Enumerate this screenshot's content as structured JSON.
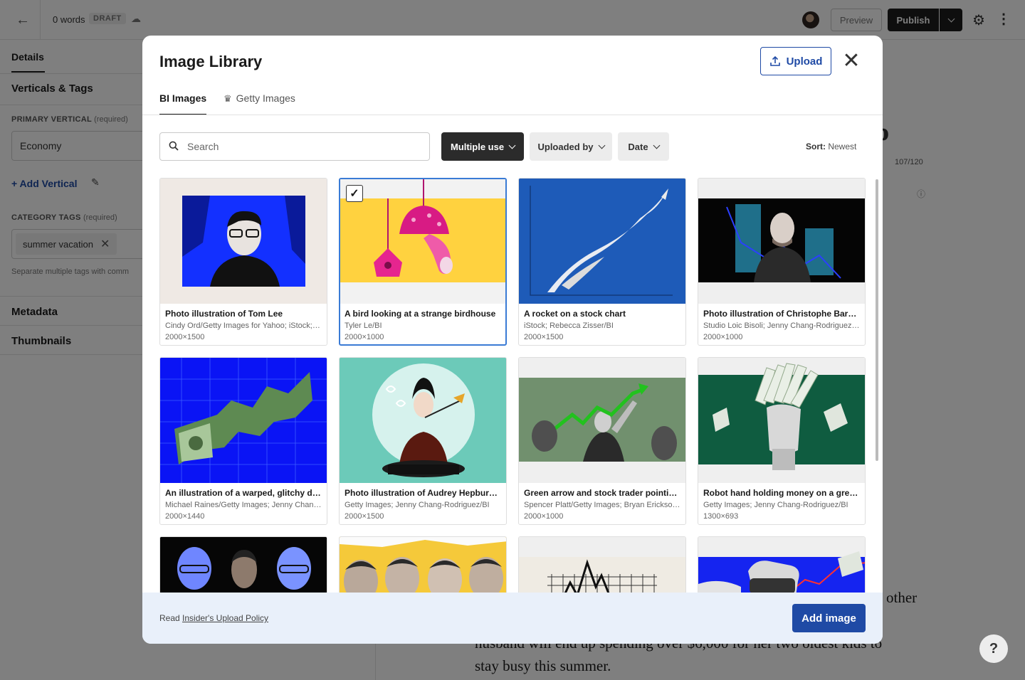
{
  "topbar": {
    "word_count": "0 words",
    "status_badge": "DRAFT",
    "preview_label": "Preview",
    "publish_label": "Publish"
  },
  "sidebar": {
    "tab_details": "Details",
    "verticals_heading": "Verticals & Tags",
    "primary_vertical_label": "PRIMARY VERTICAL",
    "required": "(required)",
    "primary_vertical_value": "Economy",
    "add_vertical": "+ Add Vertical",
    "category_tags_label": "CATEGORY TAGS",
    "tag": "summer vacation",
    "tags_hint": "Separate multiple tags with comm",
    "metadata_heading": "Metadata",
    "thumbnails_heading": "Thumbnails"
  },
  "editor": {
    "headline_fragment": "p",
    "char_counter": "107/120",
    "body_line_1_end": "other",
    "body_line_2": "husband will end up spending over $6,000 for her two oldest kids to",
    "body_line_3": "stay busy this summer.",
    "help": "?"
  },
  "modal": {
    "title": "Image Library",
    "upload_label": "Upload",
    "tabs": [
      "BI Images",
      "Getty Images"
    ],
    "active_tab": "BI Images",
    "search_placeholder": "Search",
    "filters": [
      "Multiple use",
      "Uploaded by",
      "Date"
    ],
    "sort_label": "Sort:",
    "sort_value": "Newest",
    "footer_prefix": "Read",
    "footer_link": "Insider's Upload Policy",
    "add_image_label": "Add image",
    "accent_color": "#1f4aa5",
    "selected_border_color": "#3a7bd5"
  },
  "images": [
    {
      "title": "Photo illustration of Tom Lee",
      "credit": "Cindy Ord/Getty Images for Yahoo; iStock; Jenny Chang-Rodriguez/BI",
      "dims": "2000×1500",
      "icon": "portrait-blue-icon",
      "selected": false
    },
    {
      "title": "A bird looking at a strange birdhouse",
      "credit": "Tyler Le/BI",
      "dims": "2000×1000",
      "icon": "mushroom-birdhouse-icon",
      "selected": true
    },
    {
      "title": "A rocket on a stock chart",
      "credit": "iStock; Rebecca Zisser/BI",
      "dims": "2000×1500",
      "icon": "rocket-icon",
      "selected": false
    },
    {
      "title": "Photo illustration of Christophe Barraud",
      "credit": "Studio Loic Bisoli; Jenny Chang-Rodriguez/BI",
      "dims": "2000×1000",
      "icon": "portrait-chart-icon",
      "selected": false
    },
    {
      "title": "An illustration of a warped, glitchy dollar bill",
      "credit": "Michael Raines/Getty Images; Jenny Chang-Rodriguez/BI",
      "dims": "2000×1440",
      "icon": "warped-dollar-icon",
      "selected": false
    },
    {
      "title": "Photo illustration of Audrey Hepburn in a snow globe",
      "credit": "Getty Images; Jenny Chang-Rodriguez/BI",
      "dims": "2000×1500",
      "icon": "snow-globe-icon",
      "selected": false
    },
    {
      "title": "Green arrow and stock trader pointing upward",
      "credit": "Spencer Platt/Getty Images; Bryan Erickson/BI",
      "dims": "2000×1000",
      "icon": "stock-trader-icon",
      "selected": false
    },
    {
      "title": "Robot hand holding money on a green background",
      "credit": "Getty Images; Jenny Chang-Rodriguez/BI",
      "dims": "1300×693",
      "icon": "robot-money-icon",
      "selected": false
    },
    {
      "title": "",
      "credit": "",
      "dims": "",
      "icon": "tech-ceos-icon",
      "selected": false
    },
    {
      "title": "",
      "credit": "",
      "dims": "",
      "icon": "four-men-icon",
      "selected": false
    },
    {
      "title": "",
      "credit": "",
      "dims": "",
      "icon": "line-chart-icon",
      "selected": false
    },
    {
      "title": "",
      "credit": "",
      "dims": "",
      "icon": "hand-money-icon",
      "selected": false
    }
  ]
}
